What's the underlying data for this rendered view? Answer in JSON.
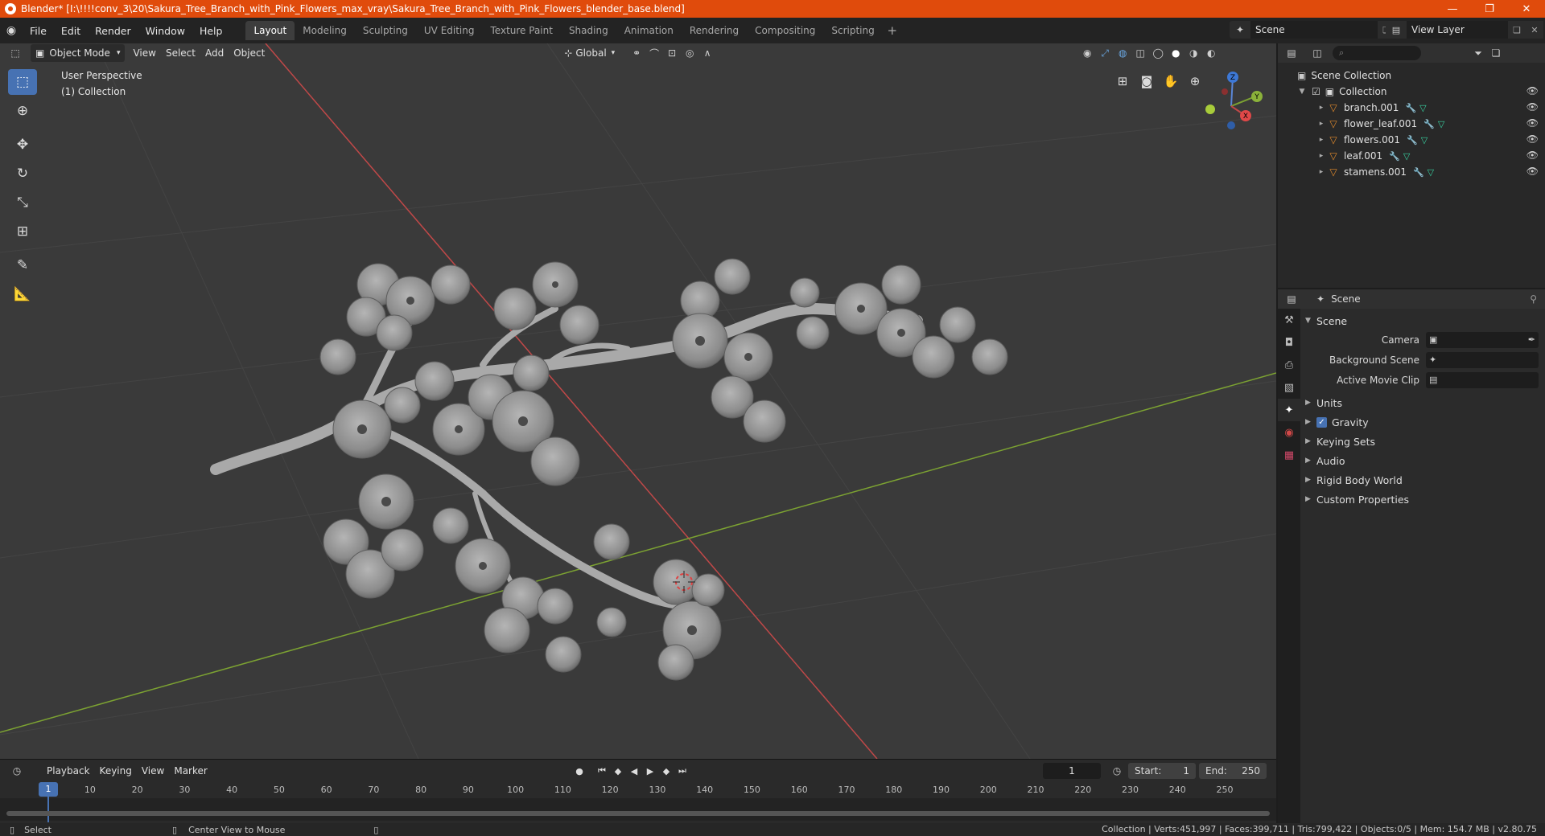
{
  "window": {
    "title": "Blender* [I:\\!!!!conv_3\\20\\Sakura_Tree_Branch_with_Pink_Flowers_max_vray\\Sakura_Tree_Branch_with_Pink_Flowers_blender_base.blend]",
    "minimize": "—",
    "maximize": "❐",
    "close": "✕"
  },
  "menu": [
    "File",
    "Edit",
    "Render",
    "Window",
    "Help"
  ],
  "workspaces": [
    "Layout",
    "Modeling",
    "Sculpting",
    "UV Editing",
    "Texture Paint",
    "Shading",
    "Animation",
    "Rendering",
    "Compositing",
    "Scripting"
  ],
  "active_workspace": "Layout",
  "scene_selector": "Scene",
  "view_layer": "View Layer",
  "viewport": {
    "mode": "Object Mode",
    "menus": [
      "View",
      "Select",
      "Add",
      "Object"
    ],
    "orientation": "Global",
    "info_line1": "User Perspective",
    "info_line2": "(1) Collection"
  },
  "gizmo": {
    "z": "Z",
    "y": "Y",
    "x": "X"
  },
  "outliner": {
    "root": "Scene Collection",
    "collection": "Collection",
    "objects": [
      "branch.001",
      "flower_leaf.001",
      "flowers.001",
      "leaf.001",
      "stamens.001"
    ]
  },
  "properties": {
    "header": "Scene",
    "section": "Scene",
    "camera_label": "Camera",
    "background_label": "Background Scene",
    "movie_clip_label": "Active Movie Clip",
    "subsections": [
      "Units",
      "Gravity",
      "Keying Sets",
      "Audio",
      "Rigid Body World",
      "Custom Properties"
    ]
  },
  "timeline": {
    "menus": [
      "Playback",
      "Keying",
      "View",
      "Marker"
    ],
    "current_frame": "1",
    "start_label": "Start:",
    "start": "1",
    "end_label": "End:",
    "end": "250",
    "ruler": [
      "1",
      "10",
      "20",
      "30",
      "40",
      "50",
      "60",
      "70",
      "80",
      "90",
      "100",
      "110",
      "120",
      "130",
      "140",
      "150",
      "160",
      "170",
      "180",
      "190",
      "200",
      "210",
      "220",
      "230",
      "240",
      "250"
    ]
  },
  "status": {
    "left": "Select",
    "middle": "Center View to Mouse",
    "right": "Collection | Verts:451,997 | Faces:399,711 | Tris:799,422 | Objects:0/5 | Mem: 154.7 MB | v2.80.75"
  },
  "colors": {
    "accent": "#4772b3",
    "title_bar": "#e04b0c",
    "x_axis": "#c04848",
    "y_axis": "#7ca232"
  }
}
